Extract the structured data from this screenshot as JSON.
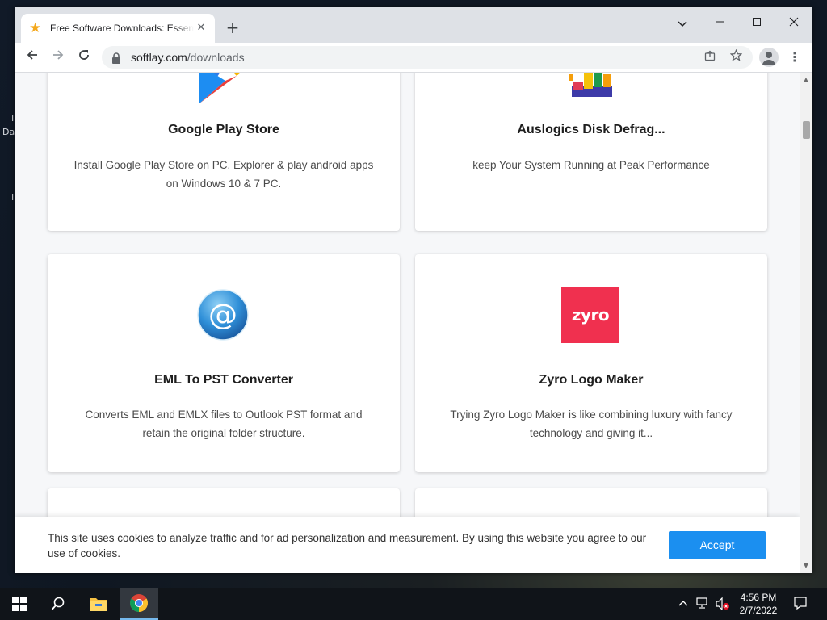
{
  "desktop": {
    "fragments": [
      "I",
      "Da",
      "I"
    ]
  },
  "browser": {
    "tab": {
      "title": "Free Software Downloads: Essential Software",
      "favicon": "star-icon",
      "close": "✕"
    },
    "new_tab": "+",
    "window_controls": {
      "minimize": "–",
      "maximize": "☐",
      "close": "✕",
      "tab_search": "⌄"
    },
    "toolbar": {
      "back": "←",
      "forward": "→",
      "reload": "↻",
      "url_host": "softlay.com",
      "url_path": "/downloads",
      "menu": "⋮"
    }
  },
  "cards": [
    {
      "title": "Google Play Store",
      "desc": "Install Google Play Store on PC. Explorer & play android apps on Windows 10 & 7 PC.",
      "icon": "google-play-icon"
    },
    {
      "title": "Auslogics Disk Defrag...",
      "desc": "keep Your System Running at Peak Performance",
      "icon": "disk-defrag-icon"
    },
    {
      "title": "EML To PST Converter",
      "desc": "Converts EML and EMLX files to Outlook PST format and retain the original folder structure.",
      "icon": "at-sign-icon"
    },
    {
      "title": "Zyro Logo Maker",
      "desc": "Trying Zyro Logo Maker is like combining luxury with fancy technology and giving it...",
      "icon": "zyro-logo",
      "logo_text": "zyro"
    }
  ],
  "cookie_banner": {
    "text": "This site uses cookies to analyze traffic and for ad personalization and measurement. By using this website you agree to our use of cookies.",
    "accept_label": "Accept"
  },
  "taskbar": {
    "time": "4:56 PM",
    "date": "2/7/2022"
  },
  "colors": {
    "accent": "#1b8ff0",
    "zyro": "#f0304f",
    "tab_strip": "#dee1e6"
  }
}
